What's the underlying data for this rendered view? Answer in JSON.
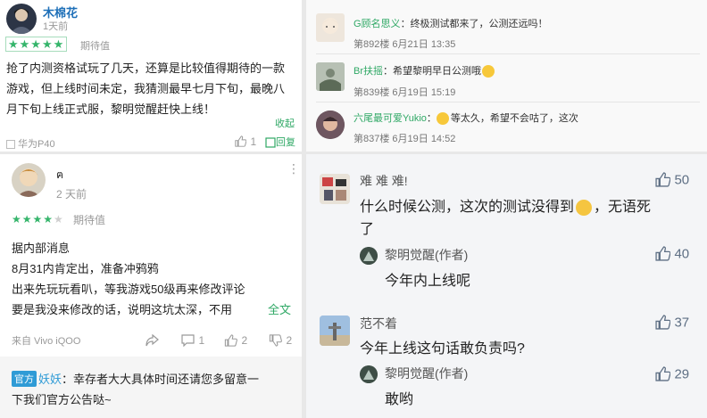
{
  "review1": {
    "user": "木棉花",
    "time": "1天前",
    "rating_stars": 5,
    "rating_text": "期待值",
    "lines": [
      "抢了内测资格试玩了几天，还算是比较值得期待的一款",
      "游戏，但上线时间未定，我猜测最早七月下旬，最晚八",
      "月下旬上线正式服，黎明觉醒赶快上线！"
    ],
    "collapse": "收起",
    "device": "华为P40",
    "like_count": "1",
    "reply_label": "回复"
  },
  "review2": {
    "user": "ฅ",
    "time": "2 天前",
    "rating_stars": 4,
    "rating_text": "期待值",
    "lines": [
      "据内部消息",
      "8月31内肯定出，准备冲鸦鸦",
      "出来先玩玩看叭，等我游戏50级再来修改评论",
      "要是我没来修改的话，说明这坑太深，不用"
    ],
    "full_text": "全文",
    "device": "来自 Vivo iQOO",
    "comment_count": "1",
    "like_count": "2",
    "dislike_count": "2",
    "official_badge": "官方",
    "official_name": "妖妖",
    "official_reply_line1": "：幸存者大大具体时间还请您多留意一",
    "official_reply_line2": "下我们官方公告哒~"
  },
  "forum": [
    {
      "user": "G顾名思义",
      "text": "：终极测试都来了，公测还远吗！",
      "meta": "第892楼 6月21日 13:35"
    },
    {
      "user": "Br扶摇",
      "text": "：希望黎明早日公测哦",
      "meta": "第839楼 6月19日 15:19"
    },
    {
      "user": "六尾最可爱Yukio",
      "text": "等太久，希望不会咕了，这次",
      "meta": "第837楼 6月19日 14:52"
    }
  ],
  "comments": [
    {
      "user": "难 难 难!",
      "text_line1": "什么时候公测，这次的测试没得到",
      "text_line1_end": "，无语死",
      "text_line2": "了",
      "likes": "50"
    },
    {
      "user": "黎明觉醒(作者)",
      "text": "今年内上线呢",
      "likes": "40"
    },
    {
      "user": "范不着",
      "text": "今年上线这句话敢负责吗?",
      "likes": "37"
    },
    {
      "user": "黎明觉醒(作者)",
      "text": "敢哟",
      "likes": "29"
    }
  ],
  "colors": {
    "green": "#35b56b",
    "forum_name": "#2fa865",
    "badge": "#2f9bd6",
    "link": "#2fa865"
  }
}
